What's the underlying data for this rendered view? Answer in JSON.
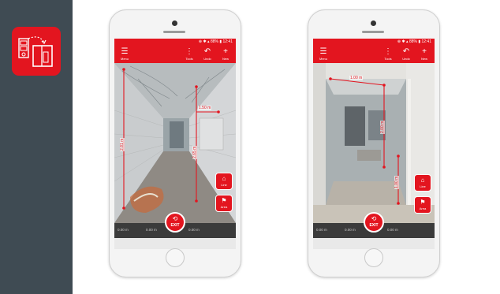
{
  "colors": {
    "brand_red": "#e3151f",
    "sidebar_bg": "#3f4b53",
    "bar_dark": "#3b3b3b"
  },
  "sidebar": {
    "app_icon": "floor-plan-measure-app-icon"
  },
  "phones": [
    {
      "status_text": "⊕ ✱ ▴ 88% ▮ 12:41",
      "toolbar": {
        "menu_label": "Menu",
        "tools_label": "Tools",
        "undo_label": "Undo",
        "new_label": "New"
      },
      "bottombar": {
        "seg1": "0.00 m",
        "seg2": "0.00 m",
        "seg3": "0.00 m"
      },
      "exit": {
        "glyph": "⟲",
        "label": "EXIT"
      },
      "side_buttons": [
        {
          "glyph": "⌂",
          "label": "Line"
        },
        {
          "glyph": "⚑",
          "label": "Area"
        }
      ],
      "measurements": {
        "horizontal": "1.50 m",
        "vertical_left": "2.81 m",
        "vertical_right": "2.65 m"
      }
    },
    {
      "status_text": "⊕ ✱ ▴ 88% ▮ 12:41",
      "toolbar": {
        "menu_label": "Menu",
        "tools_label": "Tools",
        "undo_label": "Undo",
        "new_label": "New"
      },
      "bottombar": {
        "seg1": "0.00 m",
        "seg2": "0.00 m",
        "seg3": "0.00 m"
      },
      "exit": {
        "glyph": "⟲",
        "label": "EXIT"
      },
      "side_buttons": [
        {
          "glyph": "⌂",
          "label": "Line"
        },
        {
          "glyph": "⚑",
          "label": "Area"
        }
      ],
      "measurements": {
        "top": "1.00 m",
        "vertical_upper": "2.00 m",
        "vertical_lower": "1.00 m"
      }
    }
  ]
}
